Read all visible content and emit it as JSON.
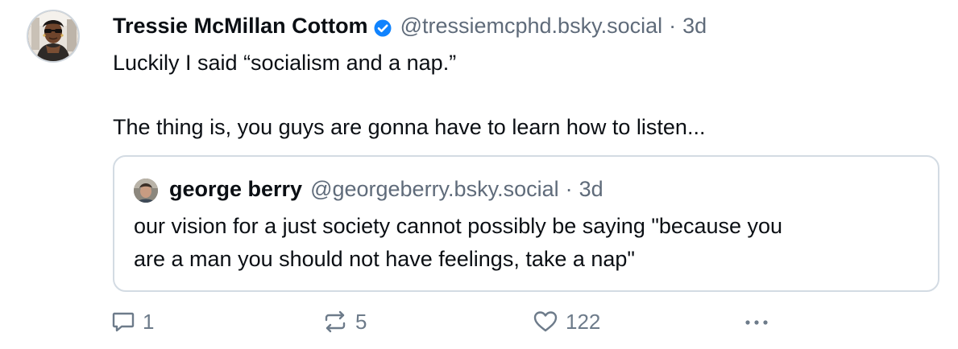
{
  "post": {
    "author": {
      "display_name": "Tressie McMillan Cottom",
      "handle": "@tressiemcphd.bsky.social",
      "separator": "·",
      "time": "3d",
      "verified_icon": "verified-badge-icon",
      "verified_color": "#1083fe"
    },
    "text_line_1": "Luckily I said “socialism and a nap.”",
    "text_line_2": "The thing is, you guys are gonna have to learn how to listen..."
  },
  "quote": {
    "author": {
      "display_name": "george berry",
      "handle": "@georgeberry.bsky.social",
      "separator": "·",
      "time": "3d"
    },
    "text_line_1": "our vision for a just society cannot possibly be saying \"because you",
    "text_line_2": "are a man you should not have feelings, take a nap\""
  },
  "actions": {
    "reply": {
      "icon": "reply-icon",
      "count": "1"
    },
    "repost": {
      "icon": "repost-icon",
      "count": "5"
    },
    "like": {
      "icon": "heart-icon",
      "count": "122"
    },
    "more": {
      "icon": "more-icon"
    }
  },
  "colors": {
    "text_primary": "#0b0f14",
    "text_secondary": "#5f6b7a",
    "action_icon": "#6d7b8a",
    "quote_border": "#d3dbe3"
  }
}
